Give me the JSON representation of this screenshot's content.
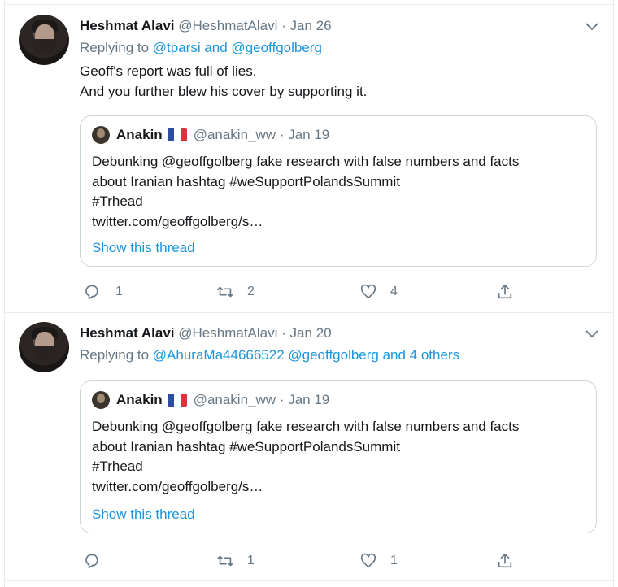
{
  "tweets": [
    {
      "author_name": "Heshmat Alavi",
      "author_handle": "@HeshmatAlavi",
      "separator": "·",
      "date": "Jan 26",
      "replying_prefix": "Replying to",
      "replying_to": "@tparsi and @geoffgolberg",
      "body_lines": [
        "Geoff's report was full of lies.",
        "And you further blew his cover by supporting it."
      ],
      "quote": {
        "name": "Anakin",
        "handle": "@anakin_ww",
        "separator": "·",
        "date": "Jan 19",
        "text_lines": [
          "Debunking @geoffgolberg fake research with false numbers and facts",
          "about Iranian hashtag #weSupportPolandsSummit",
          "#Trhead",
          "twitter.com/geoffgolberg/s…"
        ],
        "show_thread": "Show this thread"
      },
      "actions": {
        "reply_count": "1",
        "retweet_count": "2",
        "like_count": "4"
      }
    },
    {
      "author_name": "Heshmat Alavi",
      "author_handle": "@HeshmatAlavi",
      "separator": "·",
      "date": "Jan 20",
      "replying_prefix": "Replying to",
      "replying_to": "@AhuraMa44666522 @geoffgolberg and 4 others",
      "quote": {
        "name": "Anakin",
        "handle": "@anakin_ww",
        "separator": "·",
        "date": "Jan 19",
        "text_lines": [
          "Debunking @geoffgolberg fake research with false numbers and facts",
          "about Iranian hashtag #weSupportPolandsSummit",
          "#Trhead",
          "twitter.com/geoffgolberg/s…"
        ],
        "show_thread": "Show this thread"
      },
      "actions": {
        "reply_count": "",
        "retweet_count": "1",
        "like_count": "1"
      }
    }
  ],
  "icons": {
    "reply": "reply-icon",
    "retweet": "retweet-icon",
    "like": "heart-icon",
    "share": "share-icon",
    "caret": "chevron-down-icon",
    "flag": "france-flag-icon"
  },
  "colors": {
    "link": "#1b95e0",
    "muted": "#657786",
    "border": "#e6ecf0"
  }
}
